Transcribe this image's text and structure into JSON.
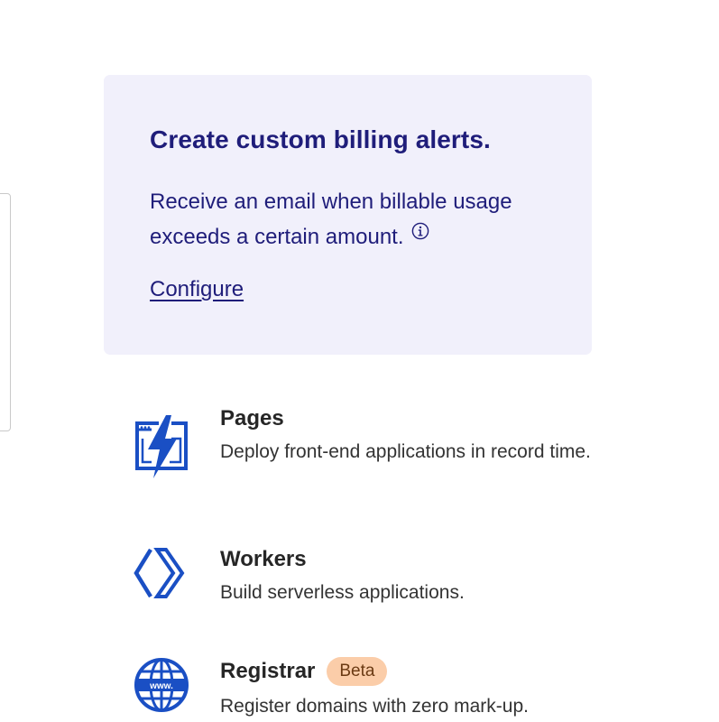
{
  "billing_alert": {
    "title": "Create custom billing alerts.",
    "description": "Receive an email when billable usage exceeds a certain amount.",
    "info_icon": "info-circle-icon",
    "link_label": "Configure"
  },
  "products": [
    {
      "name": "Pages",
      "description": "Deploy front-end applications in record time.",
      "icon": "pages-lightning-icon"
    },
    {
      "name": "Workers",
      "description": "Build serverless applications.",
      "icon": "workers-chevrons-icon"
    },
    {
      "name": "Registrar",
      "badge": "Beta",
      "description": "Register domains with zero mark-up.",
      "icon": "registrar-globe-icon"
    }
  ],
  "colors": {
    "alert_background": "#f1f0fb",
    "alert_text": "#1f1d7a",
    "icon_blue": "#1a4fc4",
    "badge_background": "#fbcda9"
  }
}
